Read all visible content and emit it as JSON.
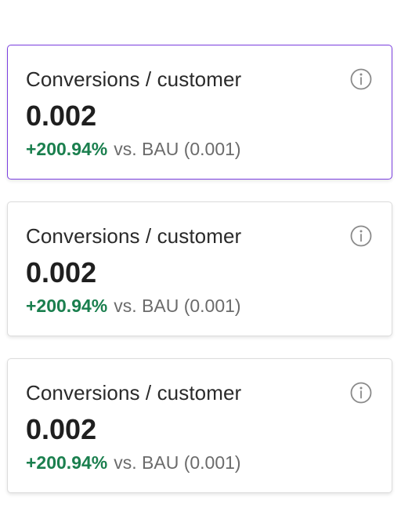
{
  "cards": [
    {
      "title": "Conversions / customer",
      "value": "0.002",
      "delta": "+200.94%",
      "baseline": "vs. BAU (0.001)",
      "icon": "info-icon",
      "selected": true
    },
    {
      "title": "Conversions / customer",
      "value": "0.002",
      "delta": "+200.94%",
      "baseline": "vs. BAU (0.001)",
      "icon": "info-icon",
      "selected": false
    },
    {
      "title": "Conversions / customer",
      "value": "0.002",
      "delta": "+200.94%",
      "baseline": "vs. BAU (0.001)",
      "icon": "info-icon",
      "selected": false
    }
  ],
  "colors": {
    "selected_border": "#7b3fe0",
    "positive": "#1a7f4e",
    "muted": "#6b6b6b",
    "card_border": "#dcdcdc"
  }
}
